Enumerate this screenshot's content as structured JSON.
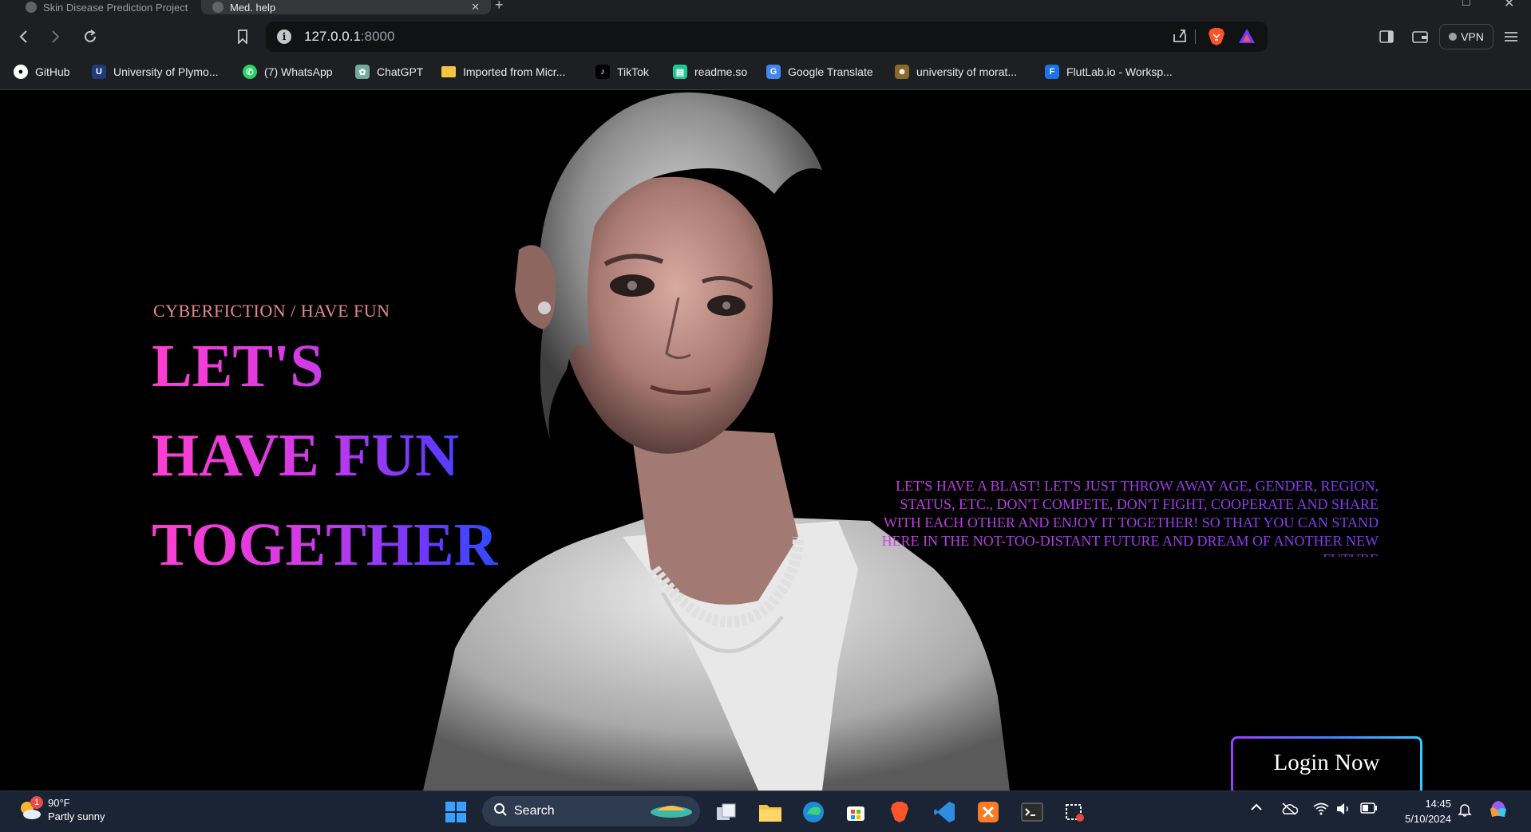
{
  "browser": {
    "tabs": [
      {
        "title": "Skin Disease Prediction Project",
        "active": false
      },
      {
        "title": "Med. help",
        "active": true
      }
    ],
    "address_bar": {
      "host": "127.0.0.1",
      "port": ":8000"
    },
    "vpn_label": "VPN",
    "bookmarks": [
      {
        "label": "GitHub",
        "icon": "github-icon"
      },
      {
        "label": "University of Plymo...",
        "icon": "university-crest-icon"
      },
      {
        "label": "(7) WhatsApp",
        "icon": "whatsapp-icon"
      },
      {
        "label": "ChatGPT",
        "icon": "chatgpt-icon"
      },
      {
        "label": "Imported from Micr...",
        "icon": "folder-icon"
      },
      {
        "label": "TikTok",
        "icon": "tiktok-icon"
      },
      {
        "label": "readme.so",
        "icon": "readme-icon"
      },
      {
        "label": "Google Translate",
        "icon": "translate-icon"
      },
      {
        "label": "university of morat...",
        "icon": "university-logo-icon"
      },
      {
        "label": "FlutLab.io - Worksp...",
        "icon": "flutlab-icon"
      }
    ]
  },
  "hero": {
    "subtitle": "CYBERFICTION / HAVE FUN",
    "headline": [
      "LET'S",
      "HAVE FUN",
      "TOGETHER"
    ],
    "blurb_lines": [
      "LET'S HAVE A BLAST! LET'S JUST THROW AWAY AGE, GENDER, REGION,",
      "STATUS, ETC., DON'T COMPETE, DON'T FIGHT, COOPERATE AND SHARE",
      "WITH EACH OTHER AND ENJOY IT TOGETHER! SO THAT YOU CAN STAND",
      "HERE IN THE NOT-TOO-DISTANT FUTURE AND DREAM OF ANOTHER NEW",
      "FUTURE"
    ],
    "login_label": "Login Now"
  },
  "taskbar": {
    "weather": {
      "temp": "90°F",
      "condition": "Partly sunny",
      "badge": "1"
    },
    "search_label": "Search",
    "clock_time": "14:45",
    "clock_date": "5/10/2024"
  },
  "colors": {
    "headline_gradient_start": "#ff3fd0",
    "headline_gradient_end": "#2a4cff",
    "subtitle": "#e68a8a",
    "login_border": "#4a7dff"
  }
}
